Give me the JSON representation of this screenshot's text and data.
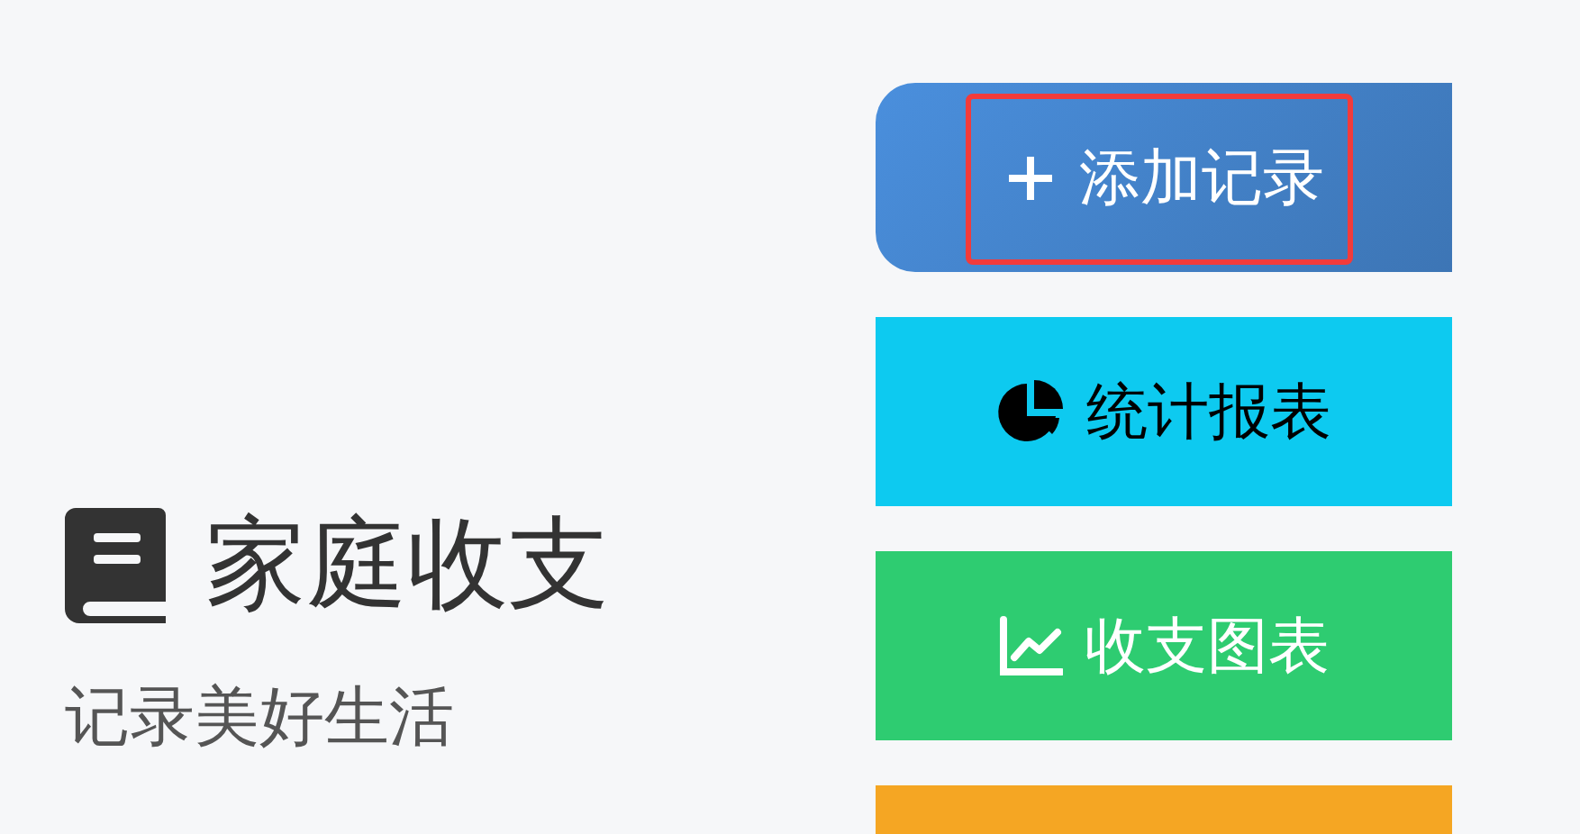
{
  "brand": {
    "title": "家庭收支",
    "subtitle": "记录美好生活"
  },
  "buttons": [
    {
      "label": "添加记录",
      "kind": "add",
      "color": "#4a8fdd",
      "rounded": true,
      "highlighted": true
    },
    {
      "label": "统计报表",
      "kind": "report",
      "color": "#0dcaf0",
      "rounded": false,
      "highlighted": false
    },
    {
      "label": "收支图表",
      "kind": "chart",
      "color": "#2ecc71",
      "rounded": false,
      "highlighted": false
    },
    {
      "kind": "blank",
      "color": "#f5a623",
      "rounded": false,
      "highlighted": false
    }
  ]
}
